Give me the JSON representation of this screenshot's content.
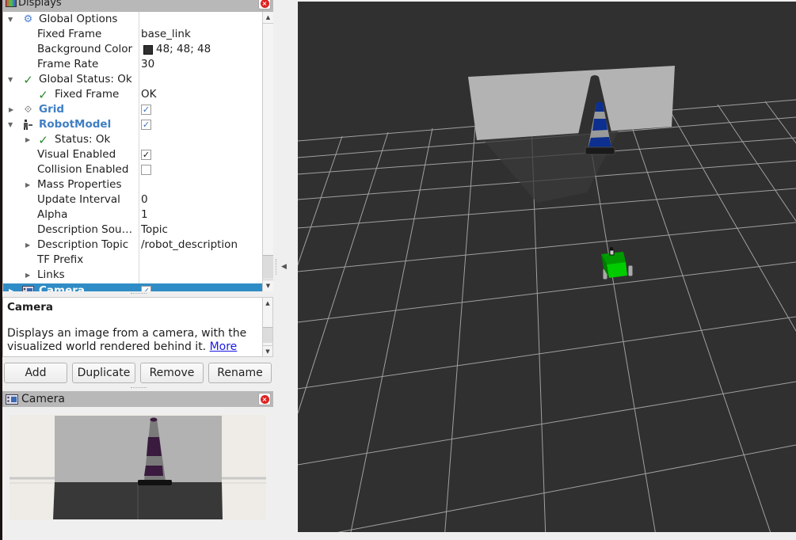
{
  "displays_panel": {
    "title": "Displays",
    "tree": [
      {
        "label": "Global Options",
        "value": "",
        "icon": "gear-icon",
        "expanded": true
      },
      {
        "label": "Fixed Frame",
        "value": "base_link"
      },
      {
        "label": "Background Color",
        "value": "48; 48; 48",
        "swatch": "#303030"
      },
      {
        "label": "Frame Rate",
        "value": "30"
      },
      {
        "label": "Global Status: Ok",
        "value": "",
        "icon": "check-icon",
        "expanded": true
      },
      {
        "label": "Fixed Frame",
        "value": "OK",
        "icon": "check-icon"
      },
      {
        "label": "Grid",
        "value": "",
        "icon": "grid-icon",
        "checked": true,
        "expanded": false
      },
      {
        "label": "RobotModel",
        "value": "",
        "icon": "robot-model-icon",
        "checked": true,
        "expanded": true
      },
      {
        "label": "Status: Ok",
        "value": "",
        "icon": "check-icon",
        "expanded": false
      },
      {
        "label": "Visual Enabled",
        "value": "",
        "checked": true
      },
      {
        "label": "Collision Enabled",
        "value": "",
        "checked": false
      },
      {
        "label": "Mass Properties",
        "value": "",
        "expanded": false
      },
      {
        "label": "Update Interval",
        "value": "0"
      },
      {
        "label": "Alpha",
        "value": "1"
      },
      {
        "label": "Description Sou…",
        "value": "Topic"
      },
      {
        "label": "Description Topic",
        "value": "/robot_description",
        "expanded": false
      },
      {
        "label": "TF Prefix",
        "value": ""
      },
      {
        "label": "Links",
        "value": "",
        "expanded": false
      },
      {
        "label": "Camera",
        "value": "",
        "icon": "camera-icon",
        "checked": true,
        "selected": true
      }
    ]
  },
  "description": {
    "title": "Camera",
    "body": "Displays an image from a camera, with the visualized world rendered behind it. ",
    "link": "More"
  },
  "buttons": {
    "add": "Add",
    "duplicate": "Duplicate",
    "remove": "Remove",
    "rename": "Rename"
  },
  "camera_panel": {
    "title": "Camera"
  },
  "colors": {
    "selection": "#308cc6",
    "link_blue": "#3f7fc4",
    "status_green": "#2a8a2a",
    "viewport_bg": "#303030",
    "robot_green": "#00cc00",
    "cone_blue": "#0d2f8f"
  },
  "glyphs": {
    "expanded": "▼",
    "collapsed": "▶",
    "check": "✓",
    "checkbox_mark": "✔",
    "gear": "⚙",
    "grid": "⟐",
    "close": "×",
    "up": "▲",
    "down": "▼",
    "collapse_left": "◀"
  }
}
